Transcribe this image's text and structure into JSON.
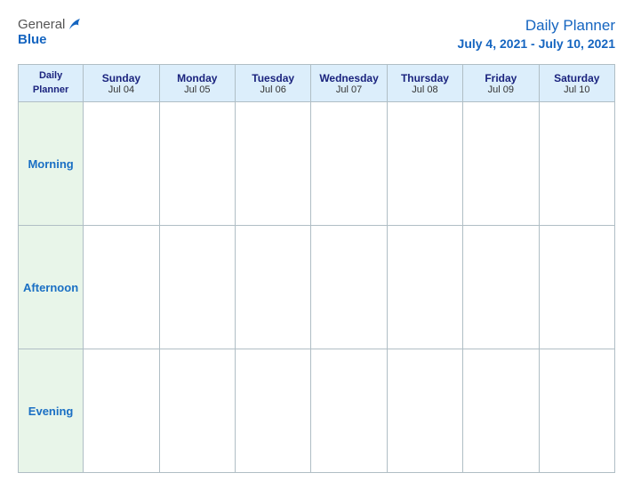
{
  "header": {
    "logo_general": "General",
    "logo_blue": "Blue",
    "title": "Daily Planner",
    "date_range": "July 4, 2021 - July 10, 2021"
  },
  "table": {
    "header_label": "Daily\nPlanner",
    "columns": [
      {
        "day": "Sunday",
        "date": "Jul 04"
      },
      {
        "day": "Monday",
        "date": "Jul 05"
      },
      {
        "day": "Tuesday",
        "date": "Jul 06"
      },
      {
        "day": "Wednesday",
        "date": "Jul 07"
      },
      {
        "day": "Thursday",
        "date": "Jul 08"
      },
      {
        "day": "Friday",
        "date": "Jul 09"
      },
      {
        "day": "Saturday",
        "date": "Jul 10"
      }
    ],
    "rows": [
      {
        "label": "Morning"
      },
      {
        "label": "Afternoon"
      },
      {
        "label": "Evening"
      }
    ]
  }
}
